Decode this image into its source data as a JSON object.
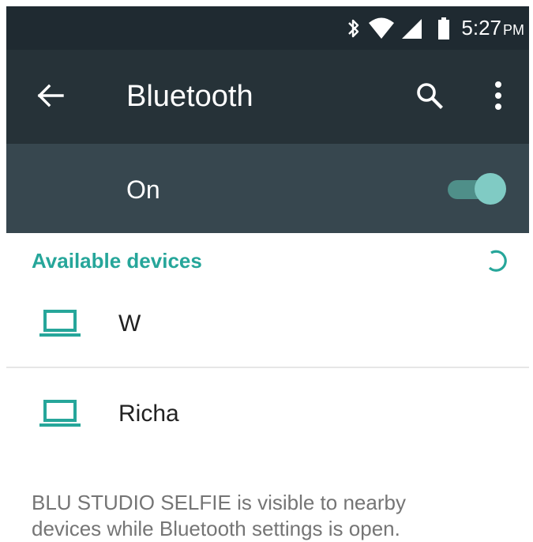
{
  "status_bar": {
    "bluetooth_icon": "bluetooth-icon",
    "wifi_icon": "wifi-icon",
    "signal_icon": "cell-signal-icon",
    "battery_icon": "battery-icon",
    "time": "5:27",
    "ampm": "PM"
  },
  "toolbar": {
    "back_icon": "arrow-back-icon",
    "title": "Bluetooth",
    "search_icon": "search-icon",
    "more_icon": "more-vert-icon"
  },
  "switch_bar": {
    "label": "On",
    "toggle_on": true
  },
  "available_devices": {
    "header": "Available devices",
    "spinner_icon": "progress-spinner-icon",
    "devices": [
      {
        "name": "W",
        "icon": "laptop-icon"
      },
      {
        "name": "Richa",
        "icon": "laptop-icon"
      }
    ]
  },
  "footer": {
    "line1": "BLU STUDIO SELFIE is visible to nearby",
    "line2": "devices while Bluetooth settings is open."
  },
  "colors": {
    "status_bar_bg": "#1f2a31",
    "toolbar_bg": "#263238",
    "switch_bar_bg": "#37474f",
    "accent": "#26a69a",
    "toggle_thumb": "#80cbc4",
    "secondary_text": "#757575"
  }
}
